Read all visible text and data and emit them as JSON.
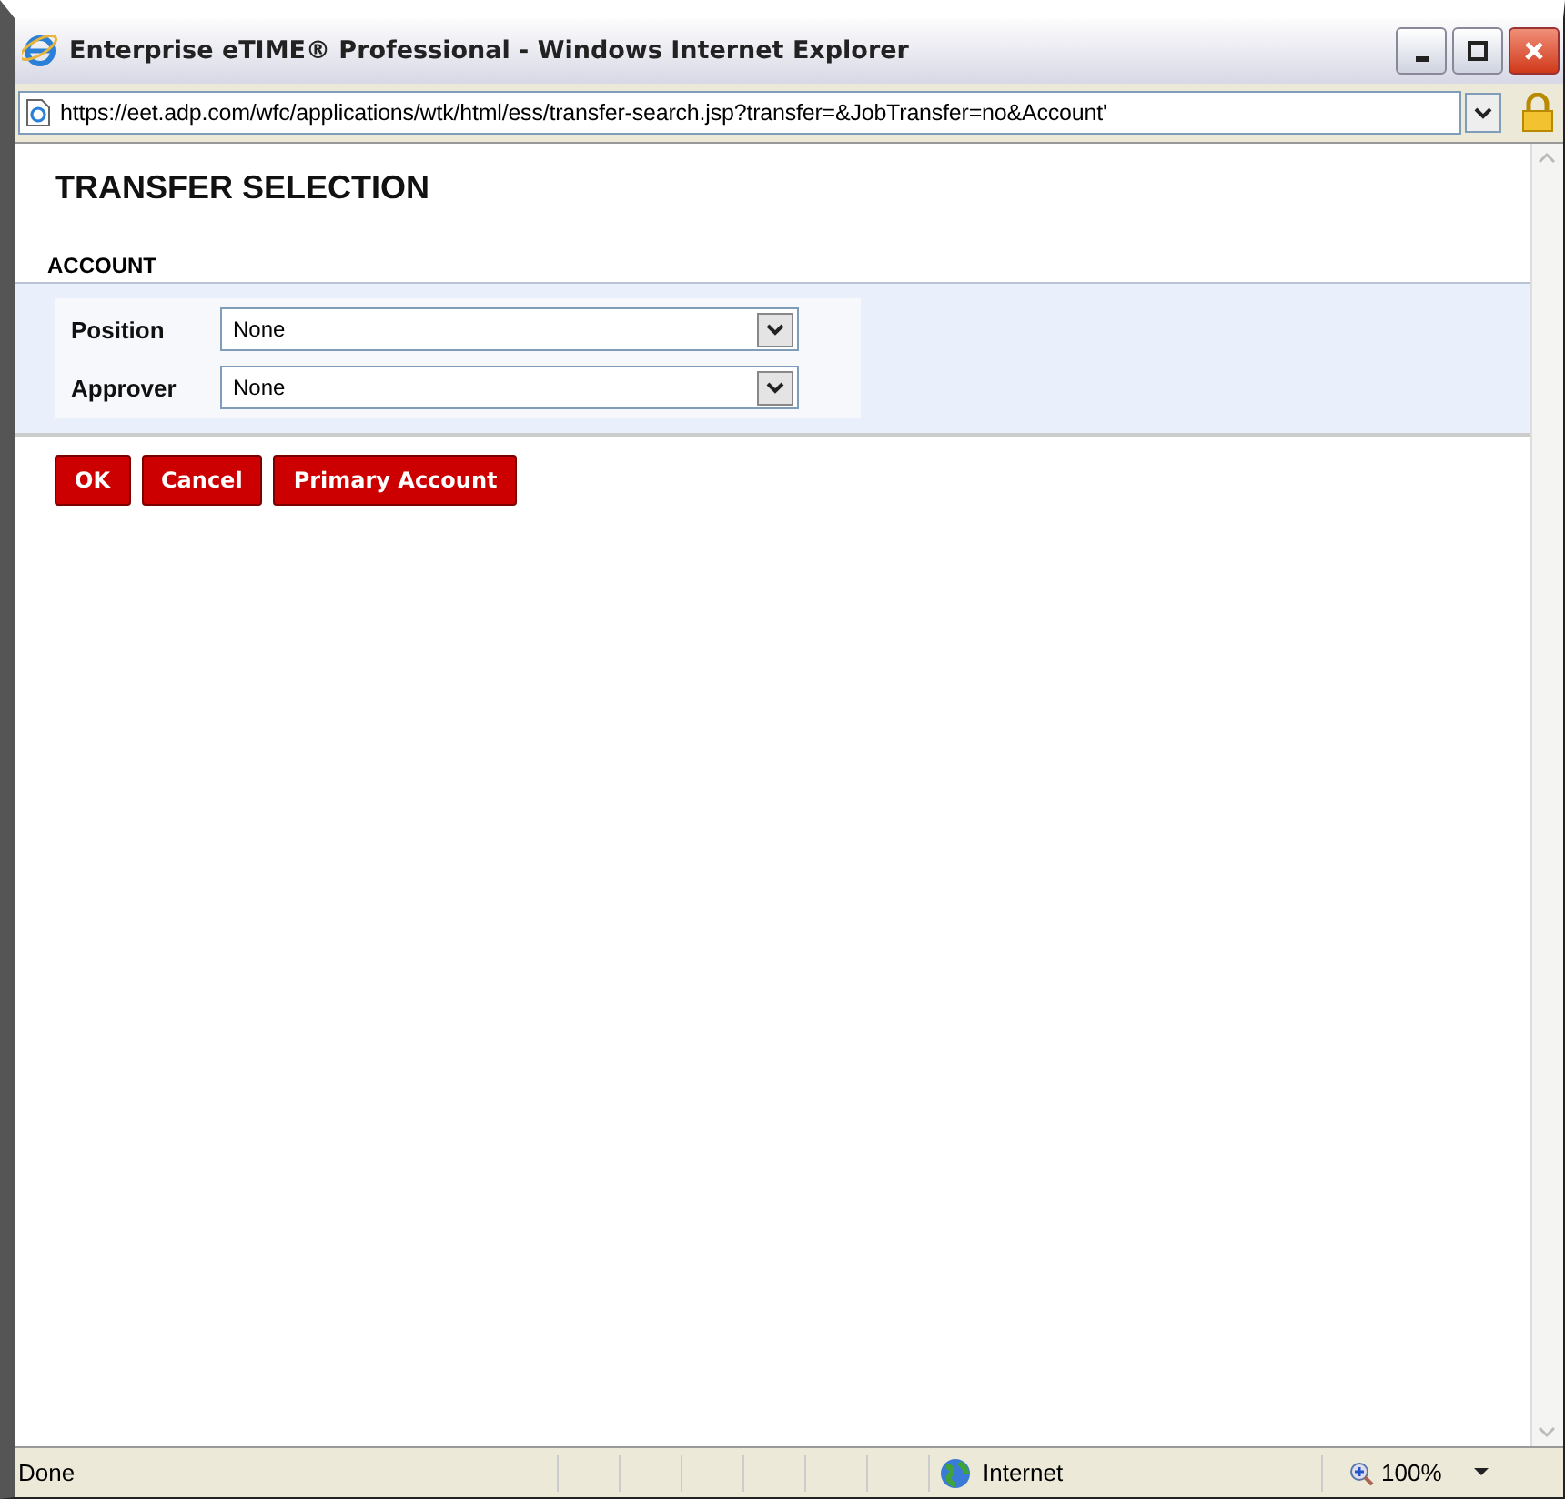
{
  "window": {
    "title": "Enterprise eTIME® Professional - Windows Internet Explorer"
  },
  "address_bar": {
    "url": "https://eet.adp.com/wfc/applications/wtk/html/ess/transfer-search.jsp?transfer=&JobTransfer=no&Account'"
  },
  "page": {
    "heading": "TRANSFER SELECTION",
    "section": "ACCOUNT",
    "fields": [
      {
        "label": "Position",
        "value": "None"
      },
      {
        "label": "Approver",
        "value": "None"
      }
    ],
    "buttons": [
      "OK",
      "Cancel",
      "Primary Account"
    ]
  },
  "status_bar": {
    "status": "Done",
    "zone": "Internet",
    "zoom": "100%"
  }
}
